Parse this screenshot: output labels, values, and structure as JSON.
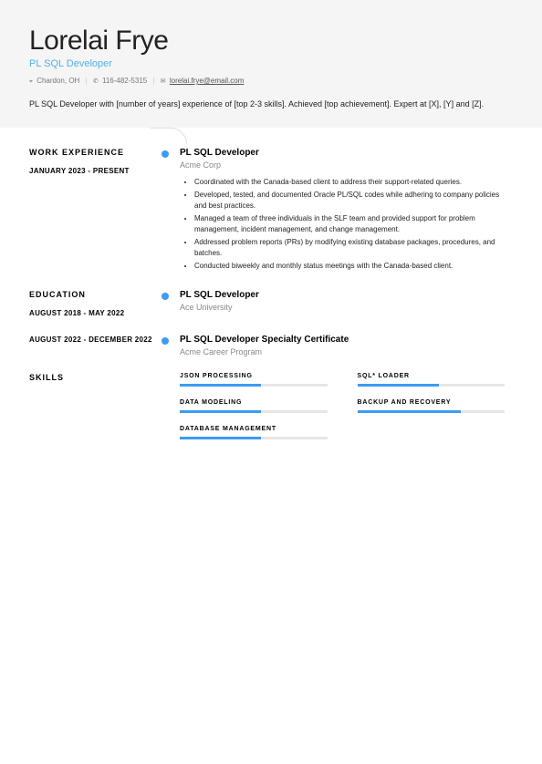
{
  "header": {
    "name": "Lorelai Frye",
    "title": "PL SQL Developer",
    "location": "Chardon, OH",
    "phone": "116-482-5315",
    "email": "lorelai.frye@email.com",
    "summary": "PL SQL Developer with [number of years] experience of [top 2-3 skills]. Achieved [top achievement]. Expert at [X], [Y] and [Z]."
  },
  "sections": {
    "work_heading": "WORK EXPERIENCE",
    "education_heading": "EDUCATION",
    "skills_heading": "SKILLS"
  },
  "work": [
    {
      "dates": "JANUARY 2023 - PRESENT",
      "title": "PL SQL Developer",
      "org": "Acme Corp",
      "bullets": [
        "Coordinated with the Canada-based client to address their support-related queries.",
        "Developed, tested, and documented Oracle PL/SQL codes while adhering to company policies and best practices.",
        "Managed a team of three individuals in the SLF team and provided support for problem management, incident management, and change management.",
        "Addressed problem reports (PRs) by modifying existing database packages, procedures, and batches.",
        "Conducted biweekly and monthly status meetings with the Canada-based client."
      ]
    }
  ],
  "education": [
    {
      "dates": "AUGUST 2018 - MAY 2022",
      "title": "PL SQL Developer",
      "org": "Ace University"
    },
    {
      "dates": "AUGUST 2022 - DECEMBER 2022",
      "title": "PL SQL Developer Specialty Certificate",
      "org": "Acme Career Program"
    }
  ],
  "skills": [
    {
      "label": "JSON PROCESSING",
      "level": 55
    },
    {
      "label": "SQL* LOADER",
      "level": 55
    },
    {
      "label": "DATA MODELING",
      "level": 55
    },
    {
      "label": "BACKUP AND RECOVERY",
      "level": 70
    },
    {
      "label": "DATABASE MANAGEMENT",
      "level": 55
    }
  ]
}
